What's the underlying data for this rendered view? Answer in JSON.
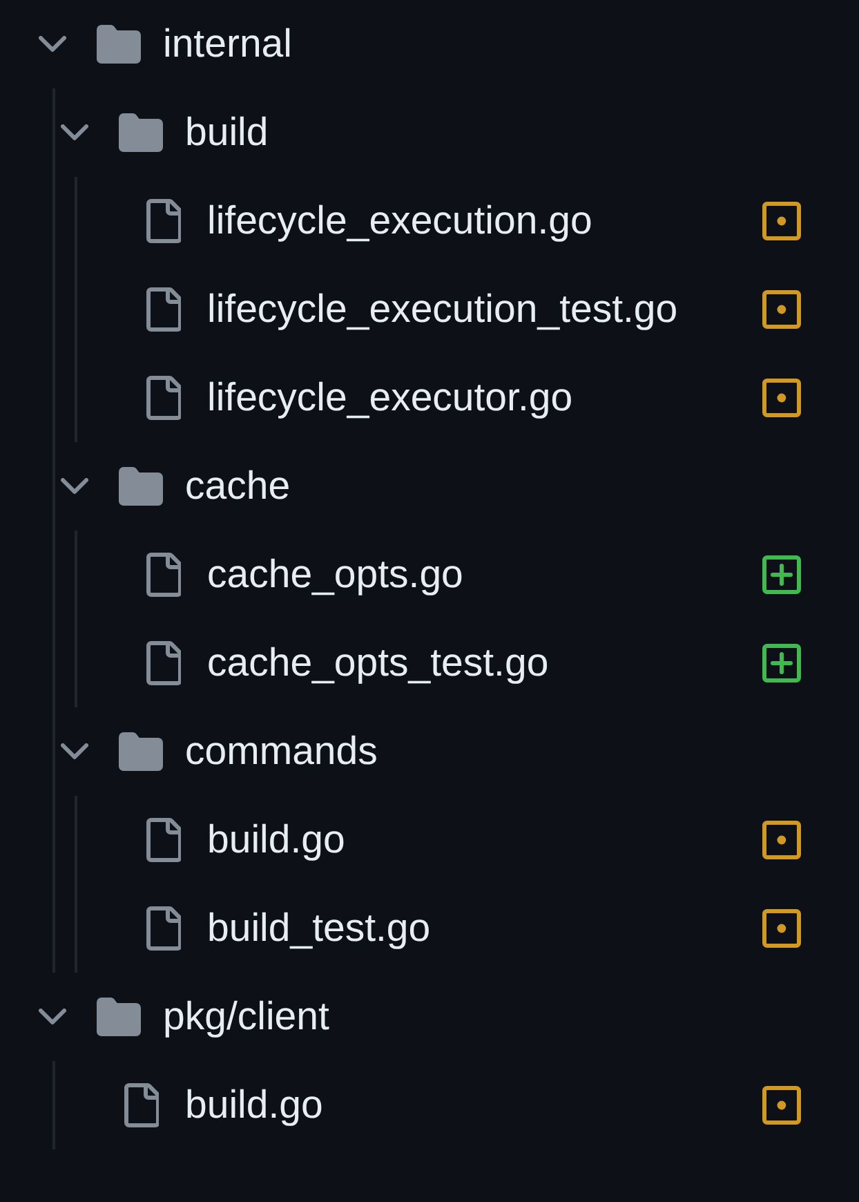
{
  "file_tree": {
    "items": [
      {
        "kind": "folder",
        "name": "internal",
        "expanded": true,
        "children": [
          {
            "kind": "folder",
            "name": "build",
            "expanded": true,
            "children": [
              {
                "kind": "file",
                "name": "lifecycle_execution.go",
                "added": false
              },
              {
                "kind": "file",
                "name": "lifecycle_execution_test.go",
                "added": false
              },
              {
                "kind": "file",
                "name": "lifecycle_executor.go",
                "added": false
              }
            ]
          },
          {
            "kind": "folder",
            "name": "cache",
            "expanded": true,
            "children": [
              {
                "kind": "file",
                "name": "cache_opts.go",
                "added": true
              },
              {
                "kind": "file",
                "name": "cache_opts_test.go",
                "added": true
              }
            ]
          },
          {
            "kind": "folder",
            "name": "commands",
            "expanded": true,
            "children": [
              {
                "kind": "file",
                "name": "build.go",
                "added": false
              },
              {
                "kind": "file",
                "name": "build_test.go",
                "added": false
              }
            ]
          }
        ]
      },
      {
        "kind": "folder",
        "name": "pkg/client",
        "expanded": true,
        "children": [
          {
            "kind": "file",
            "name": "build.go",
            "added": false
          }
        ]
      }
    ]
  }
}
